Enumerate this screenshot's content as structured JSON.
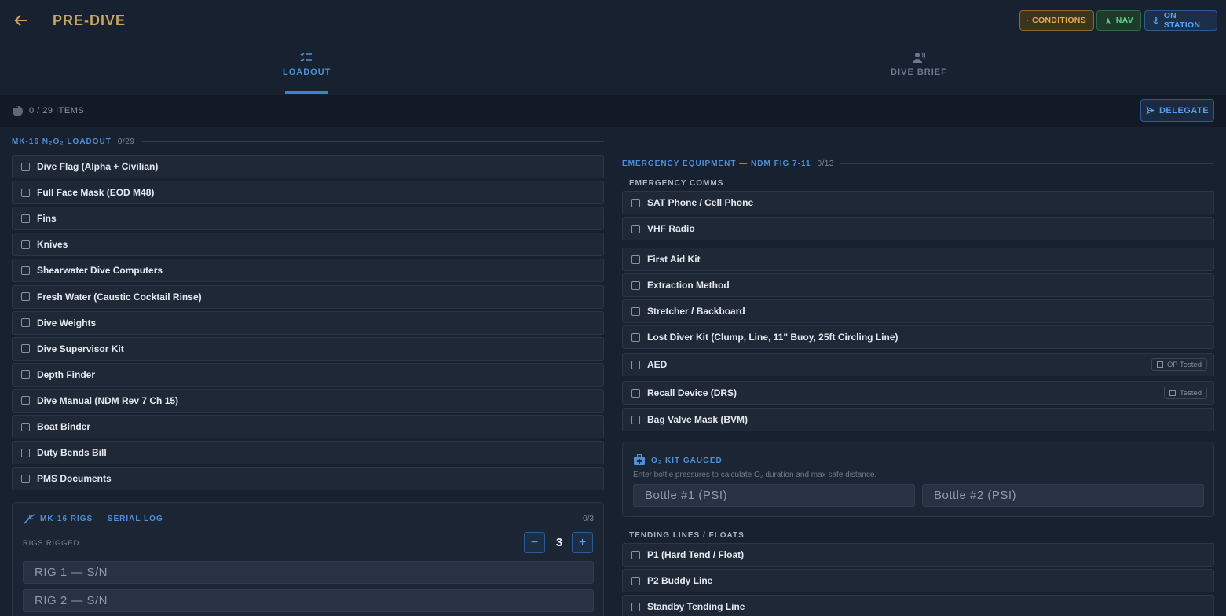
{
  "header": {
    "title": "PRE-DIVE",
    "pills": {
      "conditions": "CONDITIONS",
      "nav": "NAV",
      "on_station": "ON STATION"
    }
  },
  "tabs": [
    {
      "label": "LOADOUT",
      "active": true,
      "icon": "checklist-icon"
    },
    {
      "label": "DIVE BRIEF",
      "active": false,
      "icon": "speaker-person-icon"
    }
  ],
  "status": {
    "text": "0 / 29 ITEMS",
    "delegate_label": "DELEGATE"
  },
  "loadout": {
    "title": "MK-16 N₂O₂ LOADOUT",
    "count": "0/29",
    "items": [
      "Dive Flag (Alpha + Civilian)",
      "Full Face Mask (EOD M48)",
      "Fins",
      "Knives",
      "Shearwater Dive Computers",
      "Fresh Water (Caustic Cocktail Rinse)",
      "Dive Weights",
      "Dive Supervisor Kit",
      "Depth Finder",
      "Dive Manual (NDM Rev 7 Ch 15)",
      "Boat Binder",
      "Duty Bends Bill",
      "PMS Documents"
    ],
    "rigs": {
      "title": "MK-16 RIGS — SERIAL LOG",
      "count": "0/3",
      "rigged_label": "RIGS RIGGED",
      "rigged_value": "3",
      "minus": "−",
      "plus": "+",
      "fields": [
        "RIG 1 — S/N",
        "RIG 2 — S/N"
      ]
    }
  },
  "emergency": {
    "title": "EMERGENCY EQUIPMENT — NDM FIG 7-11",
    "count": "0/13",
    "comms_label": "EMERGENCY COMMS",
    "comms": [
      "SAT Phone / Cell Phone",
      "VHF Radio"
    ],
    "items": [
      "First Aid Kit",
      "Extraction Method",
      "Stretcher / Backboard",
      "Lost Diver Kit (Clump, Line, 11\" Buoy, 25ft Circling Line)",
      "AED",
      "Recall Device (DRS)",
      "Bag Valve Mask (BVM)"
    ],
    "aed_tag": "OP Tested",
    "recall_tag": "Tested",
    "o2": {
      "title": "O₂ KIT GAUGED",
      "desc": "Enter bottle pressures to calculate O₂ duration and max safe distance.",
      "bottle1_placeholder": "Bottle #1 (PSI)",
      "bottle2_placeholder": "Bottle #2 (PSI)"
    },
    "tending_label": "TENDING LINES / FLOATS",
    "tending": [
      "P1 (Hard Tend / Float)",
      "P2 Buddy Line",
      "Standby Tending Line"
    ]
  },
  "colors": {
    "accent": "#4e8fd6",
    "gold": "#c9a45c",
    "bg": "#172130"
  }
}
